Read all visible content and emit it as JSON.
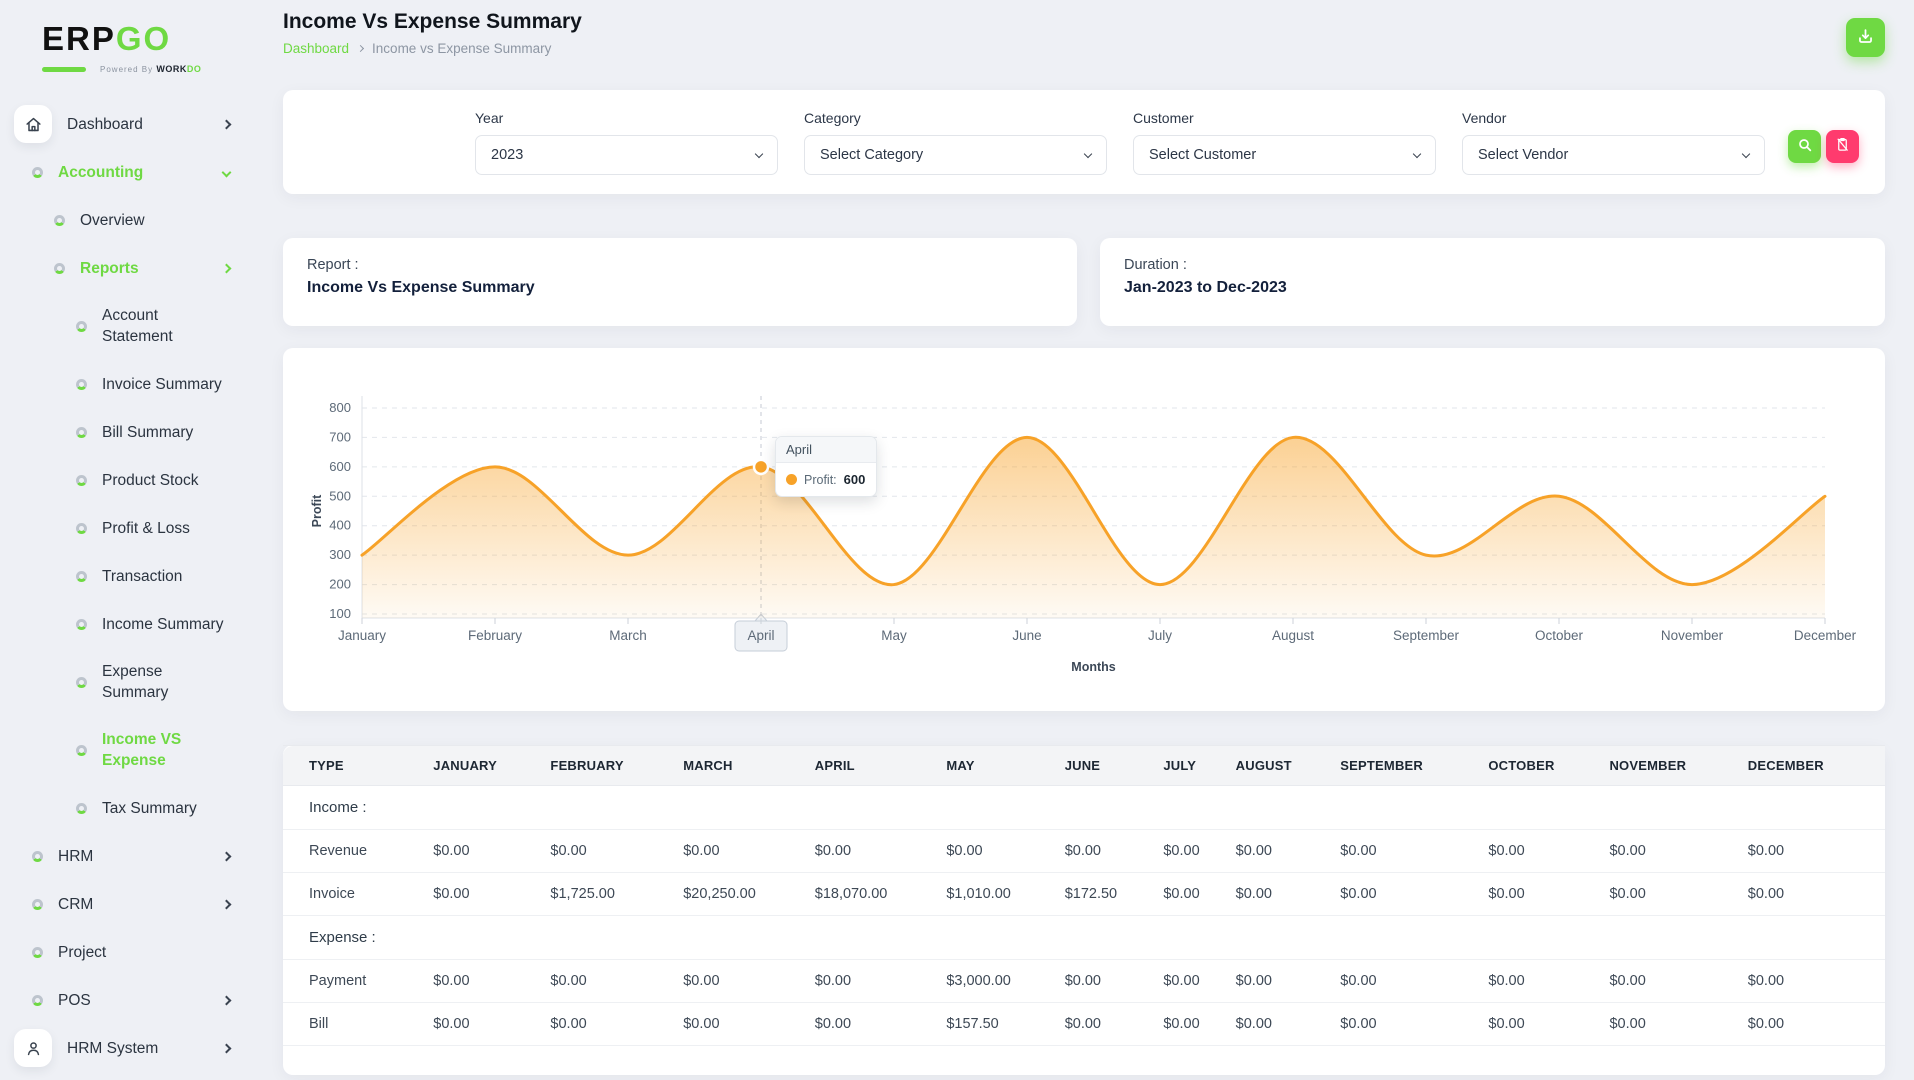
{
  "colors": {
    "accent": "#6fd943",
    "danger": "#ff3b6e",
    "chart_line": "#f7a228",
    "page_bg": "#eef0f5"
  },
  "brand": {
    "left": "ERP",
    "right": "GO",
    "powered_prefix": "Powered By",
    "powered_word": "WORK",
    "powered_accent": "DO"
  },
  "icons": [
    "home-icon",
    "donut-icon",
    "user-icon",
    "chevron-right-icon",
    "chevron-down-icon",
    "download-icon",
    "search-icon",
    "file-remove-icon",
    "series-marker-icon"
  ],
  "sidebar": {
    "items": [
      {
        "label": "Dashboard",
        "icon": "home",
        "chevron": "right",
        "level": 0
      },
      {
        "label": "Accounting",
        "icon": "donut",
        "chevron": "down",
        "level": 0,
        "active": true
      },
      {
        "label": "Overview",
        "icon": "donut",
        "level": 1
      },
      {
        "label": "Reports",
        "icon": "donut",
        "chevron": "right",
        "level": 1,
        "active": true
      },
      {
        "label": "Account\nStatement",
        "icon": "donut",
        "level": 2
      },
      {
        "label": "Invoice Summary",
        "icon": "donut",
        "level": 2
      },
      {
        "label": "Bill Summary",
        "icon": "donut",
        "level": 2
      },
      {
        "label": "Product Stock",
        "icon": "donut",
        "level": 2
      },
      {
        "label": "Profit & Loss",
        "icon": "donut",
        "level": 2
      },
      {
        "label": "Transaction",
        "icon": "donut",
        "level": 2
      },
      {
        "label": "Income Summary",
        "icon": "donut",
        "level": 2
      },
      {
        "label": "Expense\nSummary",
        "icon": "donut",
        "level": 2
      },
      {
        "label": "Income VS\nExpense",
        "icon": "donut",
        "level": 2,
        "active": true
      },
      {
        "label": "Tax Summary",
        "icon": "donut",
        "level": 2
      },
      {
        "label": "HRM",
        "icon": "donut",
        "chevron": "right",
        "level": 0
      },
      {
        "label": "CRM",
        "icon": "donut",
        "chevron": "right",
        "level": 0
      },
      {
        "label": "Project",
        "icon": "donut",
        "level": 0
      },
      {
        "label": "POS",
        "icon": "donut",
        "chevron": "right",
        "level": 0
      },
      {
        "label": "HRM System",
        "icon": "user",
        "chevron": "right",
        "level": 0
      }
    ]
  },
  "header": {
    "title": "Income Vs Expense Summary",
    "breadcrumb": [
      {
        "label": "Dashboard"
      },
      {
        "label": "Income vs Expense Summary"
      }
    ]
  },
  "filters": {
    "fields": [
      {
        "label": "Year",
        "value": "2023"
      },
      {
        "label": "Category",
        "value": "Select Category"
      },
      {
        "label": "Customer",
        "value": "Select Customer"
      },
      {
        "label": "Vendor",
        "value": "Select Vendor"
      }
    ]
  },
  "report_cards": [
    {
      "label": "Report :",
      "value": "Income Vs Expense Summary"
    },
    {
      "label": "Duration :",
      "value": "Jan-2023 to Dec-2023"
    }
  ],
  "chart_data": {
    "type": "area",
    "x": [
      "January",
      "February",
      "March",
      "April",
      "May",
      "June",
      "July",
      "August",
      "September",
      "October",
      "November",
      "December"
    ],
    "series": [
      {
        "name": "Profit",
        "values": [
          300,
          600,
          300,
          600,
          200,
          700,
          200,
          700,
          300,
          500,
          200,
          500
        ]
      }
    ],
    "title": "",
    "xlabel": "Months",
    "ylabel": "Profit",
    "ylim": [
      100,
      800
    ],
    "ytick_step": 100,
    "grid": "horizontal-dashed",
    "legend": "none",
    "highlight_index": 3,
    "line_color": "#f7a228"
  },
  "chart_tooltip": {
    "title": "April",
    "label": "Profit:",
    "value": "600"
  },
  "table": {
    "columns": [
      "TYPE",
      "JANUARY",
      "FEBRUARY",
      "MARCH",
      "APRIL",
      "MAY",
      "JUNE",
      "JULY",
      "AUGUST",
      "SEPTEMBER",
      "OCTOBER",
      "NOVEMBER",
      "DECEMBER"
    ],
    "sections": [
      {
        "label": "Income :",
        "rows": [
          {
            "type": "Revenue",
            "values": [
              "$0.00",
              "$0.00",
              "$0.00",
              "$0.00",
              "$0.00",
              "$0.00",
              "$0.00",
              "$0.00",
              "$0.00",
              "$0.00",
              "$0.00",
              "$0.00"
            ]
          },
          {
            "type": "Invoice",
            "values": [
              "$0.00",
              "$1,725.00",
              "$20,250.00",
              "$18,070.00",
              "$1,010.00",
              "$172.50",
              "$0.00",
              "$0.00",
              "$0.00",
              "$0.00",
              "$0.00",
              "$0.00"
            ]
          }
        ]
      },
      {
        "label": "Expense :",
        "rows": [
          {
            "type": "Payment",
            "values": [
              "$0.00",
              "$0.00",
              "$0.00",
              "$0.00",
              "$3,000.00",
              "$0.00",
              "$0.00",
              "$0.00",
              "$0.00",
              "$0.00",
              "$0.00",
              "$0.00"
            ]
          },
          {
            "type": "Bill",
            "values": [
              "$0.00",
              "$0.00",
              "$0.00",
              "$0.00",
              "$157.50",
              "$0.00",
              "$0.00",
              "$0.00",
              "$0.00",
              "$0.00",
              "$0.00",
              "$0.00"
            ]
          }
        ]
      }
    ]
  }
}
